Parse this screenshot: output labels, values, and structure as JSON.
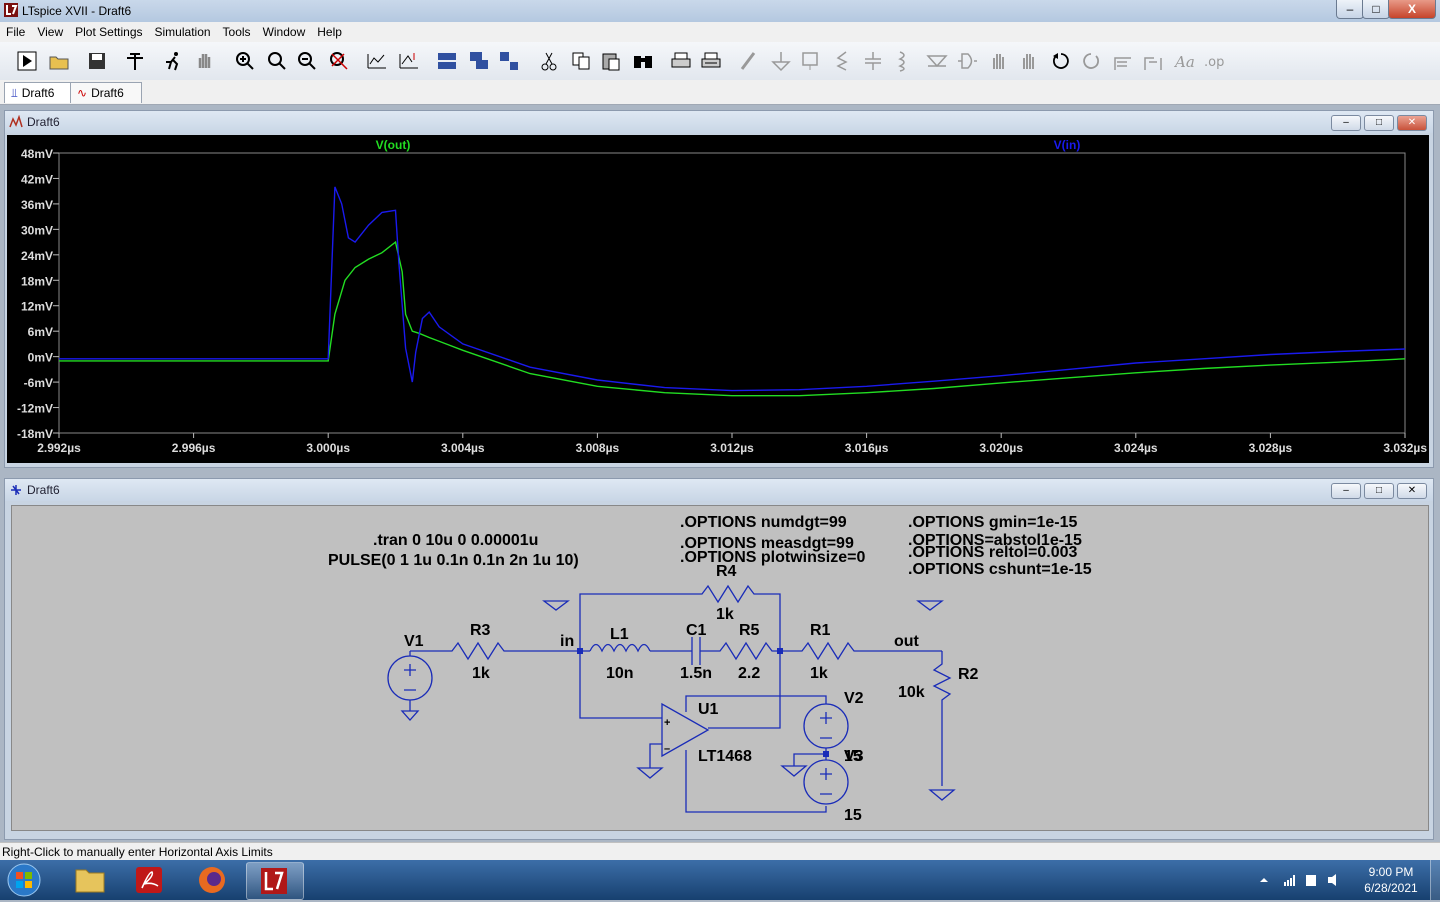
{
  "window": {
    "title": "LTspice XVII - Draft6",
    "minimize": "–",
    "maximize": "□",
    "close": "X"
  },
  "menu": [
    "File",
    "View",
    "Plot Settings",
    "Simulation",
    "Tools",
    "Window",
    "Help"
  ],
  "toolbar_icons": [
    "run-icon",
    "open-icon",
    "save-icon",
    "control-panel-icon",
    "run-man-icon",
    "pan-hand-icon",
    "zoom-in-icon",
    "zoom-rect-icon",
    "zoom-out-icon",
    "zoom-fit-icon",
    "autorange-icon",
    "marker-icon",
    "tile-horizontal-icon",
    "cascade-icon",
    "tile-icon",
    "cut-icon",
    "copy-icon",
    "paste-icon",
    "find-icon",
    "print-icon",
    "print-setup-icon",
    "wire-icon",
    "ground-icon",
    "label-icon",
    "resistor-icon",
    "capacitor-icon",
    "inductor-icon",
    "diode-icon",
    "component-icon",
    "move-icon",
    "drag-icon",
    "undo-icon",
    "redo-icon",
    "rotate-icon",
    "mirror-icon",
    "text-icon",
    "spice-directive-icon"
  ],
  "tabs": [
    {
      "label": "Draft6"
    },
    {
      "label": "Draft6"
    }
  ],
  "plot_window": {
    "title": "Draft6"
  },
  "schematic_window": {
    "title": "Draft6"
  },
  "chart_data": {
    "type": "line",
    "title": "",
    "xlabel": "",
    "ylabel": "",
    "x_unit": "µs",
    "y_unit": "mV",
    "xlim": [
      2.992,
      3.032
    ],
    "ylim": [
      -18,
      48
    ],
    "x_ticks": [
      "2.992µs",
      "2.996µs",
      "3.000µs",
      "3.004µs",
      "3.008µs",
      "3.012µs",
      "3.016µs",
      "3.020µs",
      "3.024µs",
      "3.028µs",
      "3.032µs"
    ],
    "y_ticks": [
      "48mV",
      "42mV",
      "36mV",
      "30mV",
      "24mV",
      "18mV",
      "12mV",
      "6mV",
      "0mV",
      "-6mV",
      "-12mV",
      "-18mV"
    ],
    "grid": false,
    "background": "#000000",
    "series": [
      {
        "name": "V(out)",
        "color": "#22dd22",
        "x": [
          2.992,
          2.9995,
          3.0,
          3.0002,
          3.0005,
          3.0008,
          3.0012,
          3.0016,
          3.002,
          3.0022,
          3.0023,
          3.0025,
          3.0027,
          3.003,
          3.0035,
          3.004,
          3.006,
          3.008,
          3.01,
          3.012,
          3.014,
          3.016,
          3.018,
          3.02,
          3.022,
          3.024,
          3.026,
          3.028,
          3.03,
          3.032
        ],
        "y": [
          -1,
          -1,
          -1,
          10,
          18,
          21,
          23,
          24.5,
          27,
          20,
          10,
          6,
          5.5,
          4.5,
          3,
          1.5,
          -4,
          -7,
          -8.5,
          -9.2,
          -9.2,
          -8.5,
          -7.5,
          -6.2,
          -5,
          -3.8,
          -2.8,
          -2,
          -1.3,
          -0.5
        ]
      },
      {
        "name": "V(in)",
        "color": "#1a1aee",
        "x": [
          2.992,
          2.9995,
          3.0,
          3.0002,
          3.0004,
          3.0006,
          3.0008,
          3.0012,
          3.0016,
          3.002,
          3.0021,
          3.0023,
          3.0025,
          3.0026,
          3.0028,
          3.003,
          3.0033,
          3.004,
          3.006,
          3.008,
          3.01,
          3.012,
          3.014,
          3.016,
          3.018,
          3.02,
          3.022,
          3.024,
          3.026,
          3.028,
          3.03,
          3.032
        ],
        "y": [
          -0.5,
          -0.5,
          -0.5,
          40,
          36,
          28,
          27,
          31,
          34,
          34.5,
          22,
          2,
          -6,
          1,
          9,
          10.5,
          7,
          3,
          -2.5,
          -5.5,
          -7.3,
          -8,
          -7.8,
          -7,
          -5.8,
          -4.5,
          -3,
          -1.5,
          -0.5,
          0.5,
          1.2,
          1.8
        ]
      }
    ]
  },
  "schematic": {
    "directives": {
      "tran": ".tran 0 10u 0 0.00001u",
      "pulse": "PULSE(0 1 1u 0.1n 0.1n 2n 1u 10)",
      "opt_numdgt": ".OPTIONS numdgt=99",
      "opt_measdgt": ".OPTIONS measdgt=99",
      "opt_plotwinsize": ".OPTIONS plotwinsize=0",
      "opt_gmin": ".OPTIONS gmin=1e-15",
      "opt_abstol": ".OPTIONS=abstol1e-15",
      "opt_reltol": ".OPTIONS reltol=0.003",
      "opt_cshunt": ".OPTIONS cshunt=1e-15"
    },
    "labels": {
      "v1": "V1",
      "r3": "R3",
      "r3_val": "1k",
      "net_in": "in",
      "l1": "L1",
      "l1_val": "10n",
      "c1": "C1",
      "c1_val": "1.5n",
      "r5": "R5",
      "r5_val": "2.2",
      "r4": "R4",
      "r4_val": "1k",
      "r1": "R1",
      "r1_val": "1k",
      "net_out": "out",
      "r2": "R2",
      "r2_val": "10k",
      "u1": "U1",
      "u1_part": "LT1468",
      "v2": "V2",
      "v3": "V3",
      "v3_val": "15",
      "v_overlap": "15",
      "plus": "+",
      "minus": "–"
    }
  },
  "status": "Right-Click to manually enter Horizontal Axis Limits",
  "taskbar": {
    "time": "9:00 PM",
    "date": "6/28/2021"
  },
  "colors": {
    "schematic_wire": "#1a2cb8",
    "schematic_bg": "#c0c0c0",
    "plot_bg": "#000000",
    "vout": "#22dd22",
    "vin": "#1a1aee"
  }
}
